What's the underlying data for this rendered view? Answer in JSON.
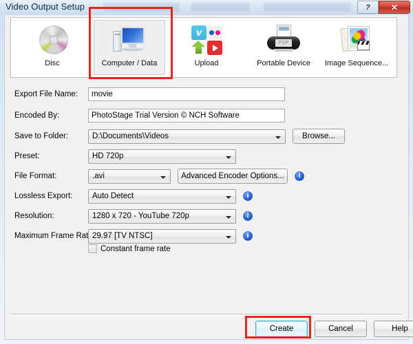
{
  "window": {
    "title": "Video Output Setup",
    "help_button": "?",
    "close_button": "✕"
  },
  "destinations": [
    {
      "id": "disc",
      "label": "Disc",
      "icon": "disc-icon",
      "selected": false
    },
    {
      "id": "computer-data",
      "label": "Computer / Data",
      "icon": "monitor-icon",
      "selected": true
    },
    {
      "id": "upload",
      "label": "Upload",
      "icon": "upload-icon",
      "selected": false
    },
    {
      "id": "portable",
      "label": "Portable Device",
      "icon": "portable-device-icon",
      "selected": false
    },
    {
      "id": "image-seq",
      "label": "Image Sequence...",
      "icon": "image-sequence-icon",
      "selected": false
    }
  ],
  "form": {
    "export_file_name": {
      "label": "Export File Name:",
      "value": "movie"
    },
    "encoded_by": {
      "label": "Encoded By:",
      "value": "PhotoStage Trial Version © NCH Software"
    },
    "save_to_folder": {
      "label": "Save to Folder:",
      "value": "D:\\Documents\\Videos",
      "browse_label": "Browse..."
    },
    "preset": {
      "label": "Preset:",
      "value": "HD 720p"
    },
    "file_format": {
      "label": "File Format:",
      "value": ".avi",
      "advanced_label": "Advanced Encoder Options..."
    },
    "lossless_export": {
      "label": "Lossless Export:",
      "value": "Auto Detect"
    },
    "resolution": {
      "label": "Resolution:",
      "value": "1280 x 720 - YouTube 720p"
    },
    "max_frame_rate": {
      "label": "Maximum Frame Rate:",
      "value": "29.97 [TV NTSC]"
    },
    "constant_frame_rate": {
      "label": "Constant frame rate",
      "checked": false
    },
    "info_glyph": "i",
    "dropdown_glyph": "▼"
  },
  "footer": {
    "create": "Create",
    "cancel": "Cancel",
    "help": "Help"
  },
  "annotations": {
    "color": "#e8231a",
    "targets": [
      "computer-data-destination",
      "create-button"
    ]
  }
}
